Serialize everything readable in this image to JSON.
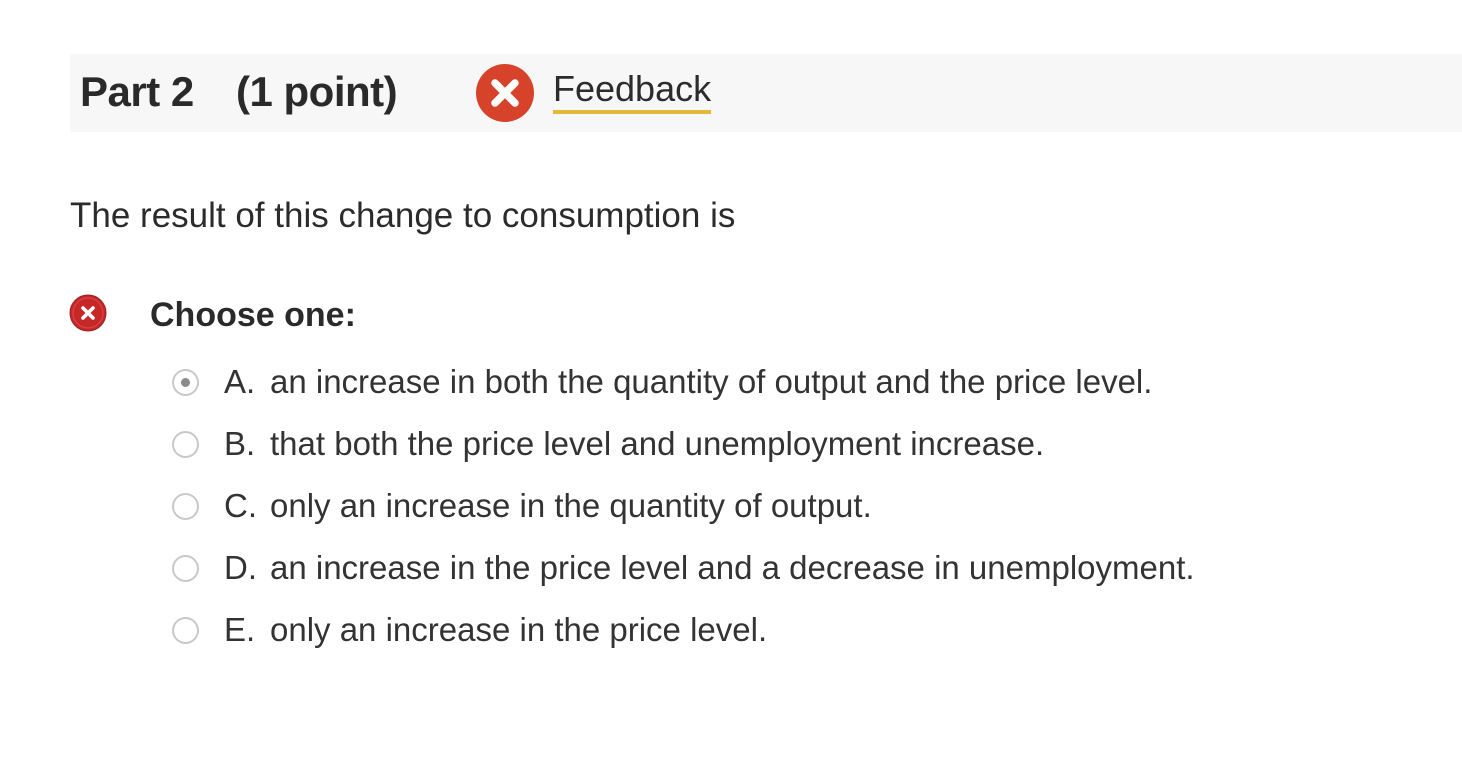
{
  "part": {
    "title": "Part 2",
    "points": "(1 point)",
    "feedback_label": "Feedback",
    "status_icon": "close-circle-icon",
    "status_color": "#d6422a"
  },
  "question": {
    "text": "The result of this change to consumption is",
    "choose_label": "Choose one:",
    "result_icon": "incorrect-x-icon",
    "result_color": "#c62828",
    "selected_option": "A",
    "options": [
      {
        "letter": "A.",
        "text": "an increase in both the quantity of output and the price level."
      },
      {
        "letter": "B.",
        "text": "that both the price level and unemployment increase."
      },
      {
        "letter": "C.",
        "text": "only an increase in the quantity of output."
      },
      {
        "letter": "D.",
        "text": "an increase in the price level and a decrease in unemployment."
      },
      {
        "letter": "E.",
        "text": "only an increase in the price level."
      }
    ]
  },
  "colors": {
    "header_background": "#f7f7f7",
    "feedback_underline": "#e3b93a"
  }
}
